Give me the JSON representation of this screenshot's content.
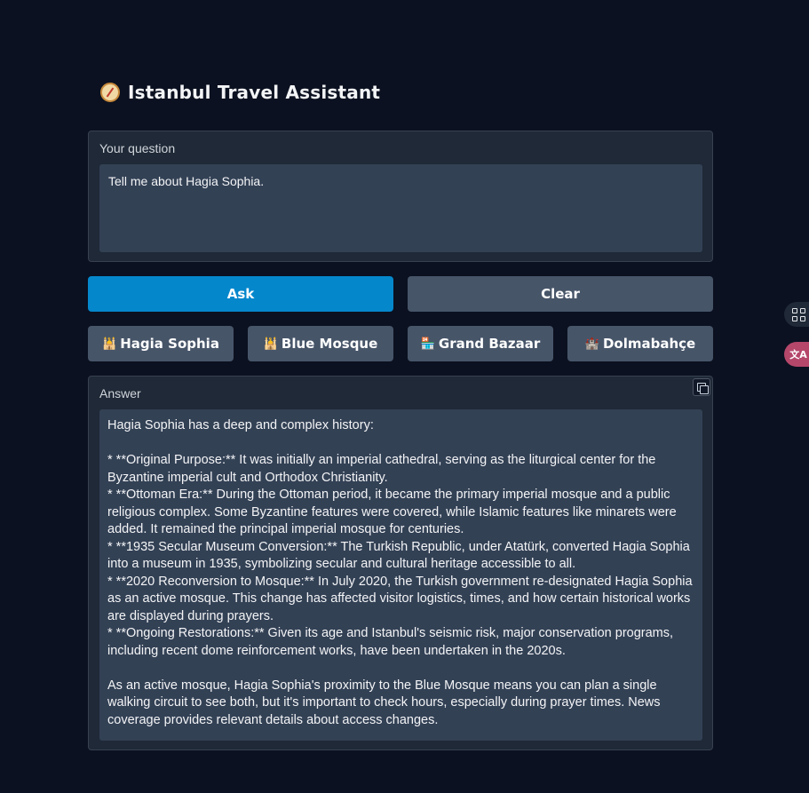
{
  "app": {
    "title": "Istanbul Travel Assistant",
    "title_icon": "compass-icon"
  },
  "question": {
    "label": "Your question",
    "value": "Tell me about Hagia Sophia."
  },
  "buttons": {
    "ask": "Ask",
    "clear": "Clear"
  },
  "chips": [
    {
      "icon": "🕌",
      "label": "Hagia Sophia"
    },
    {
      "icon": "🕌",
      "label": "Blue Mosque"
    },
    {
      "icon": "🏪",
      "label": "Grand Bazaar"
    },
    {
      "icon": "🏰",
      "label": "Dolmabahçe"
    }
  ],
  "answer": {
    "label": "Answer",
    "paragraphs": [
      "Hagia Sophia has a deep and complex history:",
      "",
      "*   **Original Purpose:** It was initially an imperial cathedral, serving as the liturgical center for the Byzantine imperial cult and Orthodox Christianity.",
      "*   **Ottoman Era:** During the Ottoman period, it became the primary imperial mosque and a public religious complex. Some Byzantine features were covered, while Islamic features like minarets were added. It remained the principal imperial mosque for centuries.",
      "*   **1935 Secular Museum Conversion:** The Turkish Republic, under Atatürk, converted Hagia Sophia into a museum in 1935, symbolizing secular and cultural heritage accessible to all.",
      "*   **2020 Reconversion to Mosque:** In July 2020, the Turkish government re-designated Hagia Sophia as an active mosque. This change has affected visitor logistics, times, and how certain historical works are displayed during prayers.",
      "*   **Ongoing Restorations:** Given its age and Istanbul's seismic risk, major conservation programs, including recent dome reinforcement works, have been undertaken in the 2020s.",
      "",
      "As an active mosque, Hagia Sophia's proximity to the Blue Mosque means you can plan a single walking circuit to see both, but it's important to check hours, especially during prayer times. News coverage provides relevant details about access changes."
    ]
  },
  "colors": {
    "background": "#0b1120",
    "panel": "#1f2937",
    "input": "#334155",
    "primary": "#0587cc",
    "secondary": "#475569"
  },
  "side_tools": [
    "apps-icon",
    "translate-icon"
  ]
}
